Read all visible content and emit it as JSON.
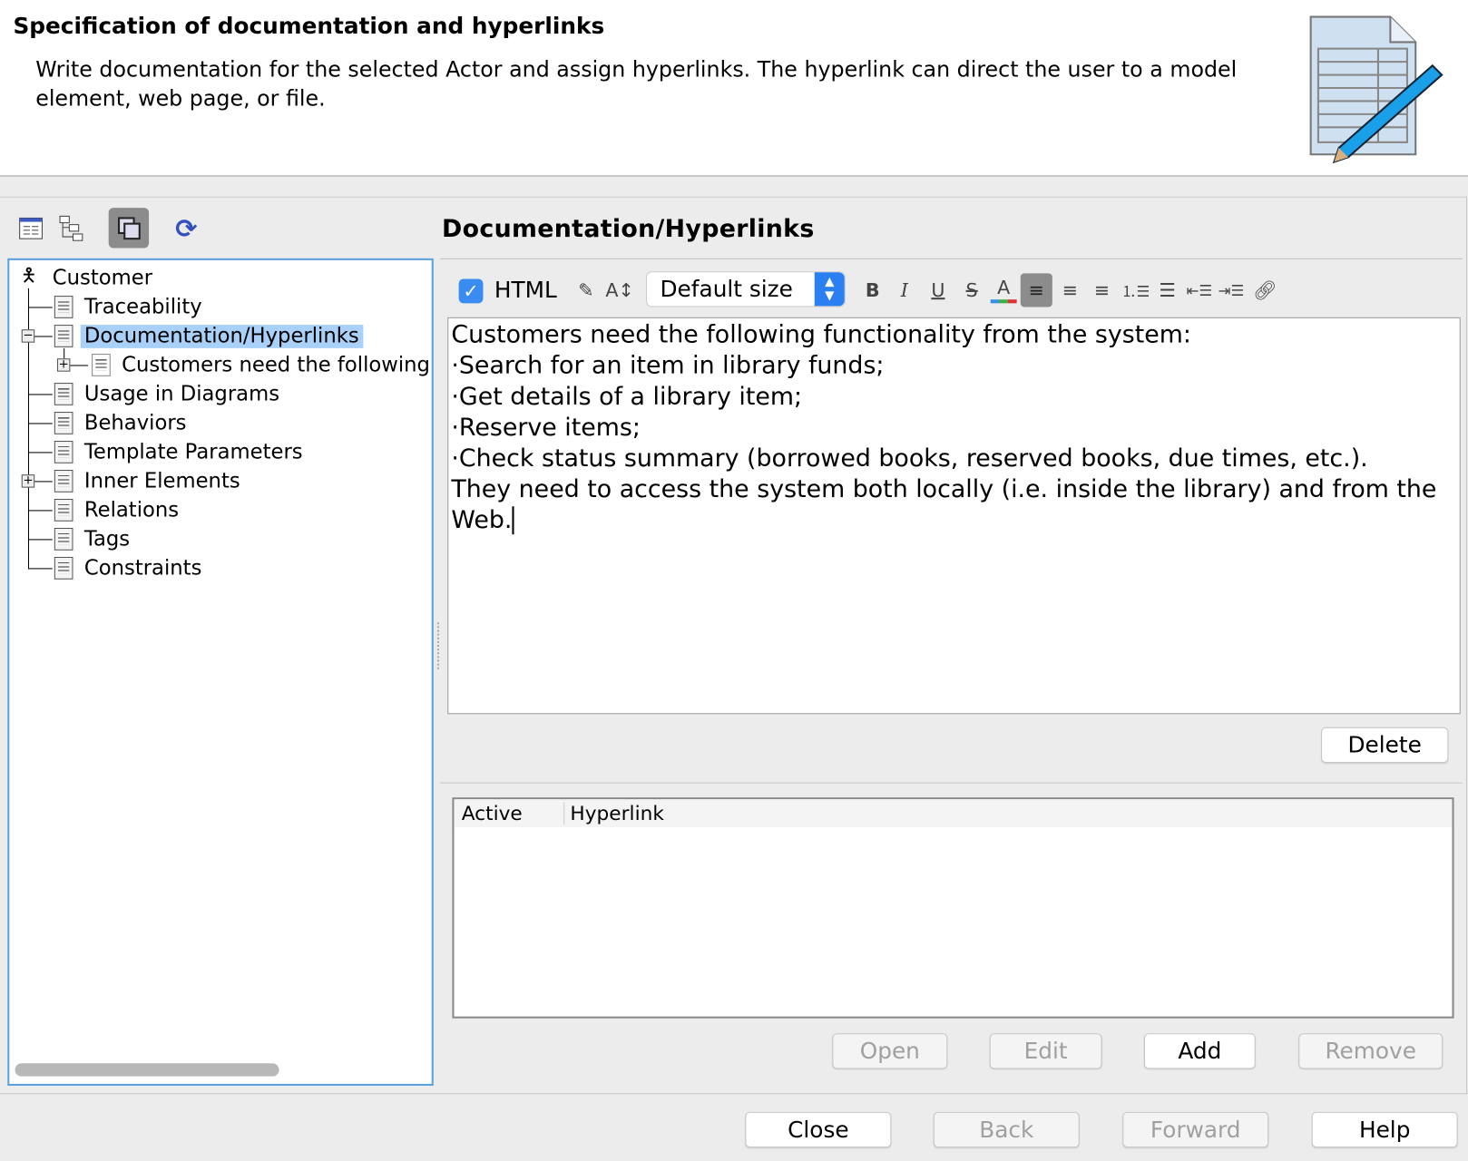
{
  "header": {
    "title": "Specification of documentation and hyperlinks",
    "description": "Write documentation for the selected Actor and assign hyperlinks. The hyperlink can direct the user to a model element, web page, or file."
  },
  "tree": {
    "root": "Customer",
    "items": [
      "Traceability",
      "Documentation/Hyperlinks",
      "Customers need the following",
      "Usage in Diagrams",
      "Behaviors",
      "Template Parameters",
      "Inner Elements",
      "Relations",
      "Tags",
      "Constraints"
    ],
    "selected": "Documentation/Hyperlinks"
  },
  "right": {
    "title": "Documentation/Hyperlinks",
    "html_label": "HTML",
    "html_checked": true,
    "font_size": "Default size",
    "bold": "B",
    "italic": "I",
    "underline": "U",
    "strike": "S",
    "color": "A",
    "doc_lines": [
      "Customers need the following functionality from the system:",
      "·Search for an item in library funds;",
      "·Get details of a library item;",
      "·Reserve items;",
      "·Check status summary (borrowed books, reserved books, due times, etc.).",
      "They need to access the system both locally (i.e. inside the library) and from the",
      "Web."
    ],
    "delete_label": "Delete",
    "table": {
      "columns": [
        "Active",
        "Hyperlink"
      ],
      "rows": []
    },
    "buttons": {
      "open": "Open",
      "edit": "Edit",
      "add": "Add",
      "remove": "Remove"
    }
  },
  "footer": {
    "close": "Close",
    "back": "Back",
    "forward": "Forward",
    "help": "Help"
  },
  "colors": {
    "accent": "#3b8cf0",
    "selection": "#a8d0f8",
    "tree_border": "#5aa0dc"
  }
}
